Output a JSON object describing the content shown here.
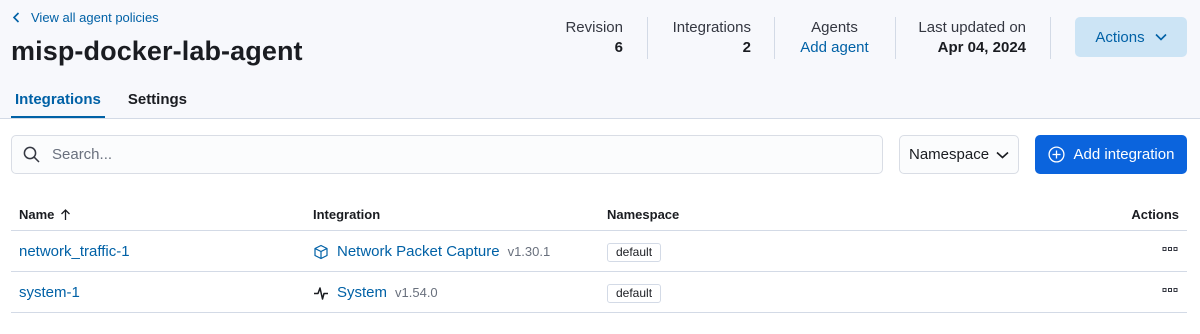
{
  "header": {
    "back_link": "View all agent policies",
    "title": "misp-docker-lab-agent",
    "stats": {
      "revision": {
        "label": "Revision",
        "value": "6"
      },
      "integrations": {
        "label": "Integrations",
        "value": "2"
      },
      "agents": {
        "label": "Agents",
        "link": "Add agent"
      },
      "last_updated": {
        "label": "Last updated on",
        "value": "Apr 04, 2024"
      }
    },
    "actions_label": "Actions"
  },
  "tabs": [
    {
      "label": "Integrations",
      "active": true
    },
    {
      "label": "Settings",
      "active": false
    }
  ],
  "toolbar": {
    "search_placeholder": "Search...",
    "namespace_label": "Namespace",
    "add_integration_label": "Add integration"
  },
  "table": {
    "columns": [
      "Name",
      "Integration",
      "Namespace",
      "Actions"
    ],
    "sort_column": "Name",
    "rows": [
      {
        "name": "network_traffic-1",
        "integration": "Network Packet Capture",
        "version": "v1.30.1",
        "namespace": "default",
        "icon": "package-icon"
      },
      {
        "name": "system-1",
        "integration": "System",
        "version": "v1.54.0",
        "namespace": "default",
        "icon": "heartbeat-icon"
      }
    ]
  },
  "colors": {
    "link": "#0061a6",
    "primary_button": "#0b64dd",
    "secondary_button": "#cce4f5",
    "header_background": "#f7f8fc"
  }
}
